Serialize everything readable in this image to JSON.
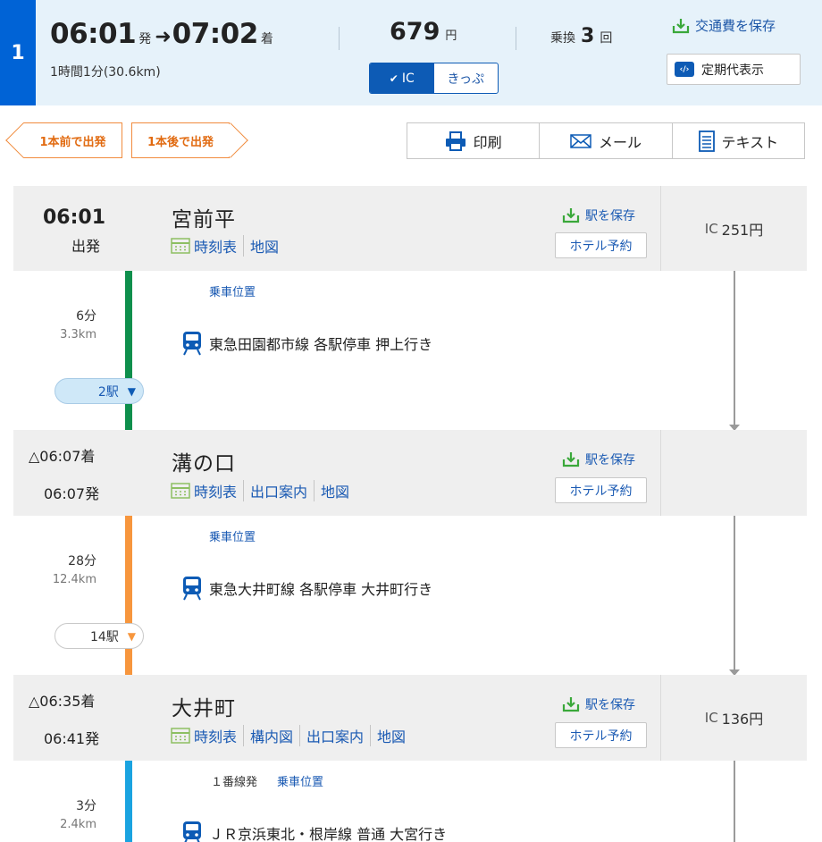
{
  "route": {
    "number": "1",
    "depart_time": "06:01",
    "depart_suffix": "発",
    "arrive_time": "07:02",
    "arrive_suffix": "着",
    "duration": "1時間1分(30.6km)",
    "fare_amount": "679",
    "fare_unit": "円",
    "fare_tabs": [
      "IC",
      "きっぷ"
    ],
    "transfers_label": "乗換",
    "transfers_count": "3",
    "transfers_unit": "回",
    "save_fare_label": "交通費を保存",
    "pass_label": "定期代表示",
    "brand_color": "#0063d6"
  },
  "actions": {
    "prev_label": "1本前で出発",
    "next_label": "1本後で出発",
    "print_label": "印刷",
    "mail_label": "メール",
    "text_label": "テキスト"
  },
  "stations": [
    {
      "arrive": "",
      "depart": "06:01",
      "depart_note": "出発",
      "name": "宮前平",
      "links": [
        "時刻表",
        "地図"
      ],
      "save_label": "駅を保存",
      "hotel_label": "ホテル予約",
      "fare_prefix": "IC",
      "fare_value": "251円"
    },
    {
      "arrive": "△06:07着",
      "depart": "06:07発",
      "name": "溝の口",
      "links": [
        "時刻表",
        "出口案内",
        "地図"
      ],
      "save_label": "駅を保存",
      "hotel_label": "ホテル予約",
      "fare_prefix": "",
      "fare_value": ""
    },
    {
      "arrive": "△06:35着",
      "depart": "06:41発",
      "name": "大井町",
      "links": [
        "時刻表",
        "構内図",
        "出口案内",
        "地図"
      ],
      "save_label": "駅を保存",
      "hotel_label": "ホテル予約",
      "fare_prefix": "IC",
      "fare_value": "136円"
    }
  ],
  "segments": [
    {
      "minutes": "6分",
      "distance": "3.3km",
      "platform": "",
      "boarding_label": "乗車位置",
      "train": "東急田園都市線 各駅停車 押上行き",
      "stops": "2駅",
      "line_color": "#0e8f4c"
    },
    {
      "minutes": "28分",
      "distance": "12.4km",
      "platform": "",
      "boarding_label": "乗車位置",
      "train": "東急大井町線 各駅停車 大井町行き",
      "stops": "14駅",
      "line_color": "#f7963d"
    },
    {
      "minutes": "3分",
      "distance": "2.4km",
      "platform": "１番線発",
      "boarding_label": "乗車位置",
      "train": "ＪＲ京浜東北・根岸線 普通 大宮行き",
      "stops": "",
      "line_color": "#1aa3e0"
    }
  ]
}
